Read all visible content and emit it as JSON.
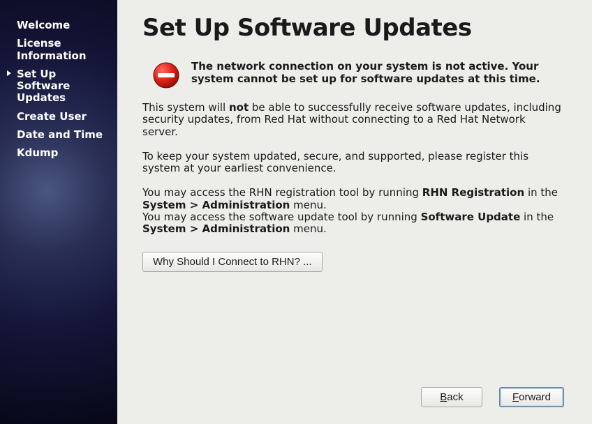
{
  "sidebar": {
    "items": [
      {
        "label": "Welcome",
        "active": false
      },
      {
        "label": "License Information",
        "active": false
      },
      {
        "label": "Set Up Software Updates",
        "active": true
      },
      {
        "label": "Create User",
        "active": false
      },
      {
        "label": "Date and Time",
        "active": false
      },
      {
        "label": "Kdump",
        "active": false
      }
    ]
  },
  "title": "Set Up Software Updates",
  "alert": "The network connection on your system is not active. Your system cannot be set up for software updates at this time.",
  "para1_a": "This system will ",
  "para1_b": "not",
  "para1_c": " be able to successfully receive software updates, including security updates, from Red Hat without connecting to a Red Hat Network server.",
  "para2": "To keep your system updated, secure, and supported, please register this system at your earliest convenience.",
  "para3_a": "You may access the RHN registration tool by running ",
  "para3_b": "RHN Registration",
  "para3_c": " in the ",
  "para3_d": "System > Administration",
  "para3_e": " menu.",
  "para4_a": "You may access the software update tool by running ",
  "para4_b": "Software Update",
  "para4_c": " in the ",
  "para4_d": "System > Administration",
  "para4_e": " menu.",
  "why_button": "Why Should I Connect to RHN? ...",
  "back_mn": "B",
  "back_rest": "ack",
  "forward_mn": "F",
  "forward_rest": "orward"
}
